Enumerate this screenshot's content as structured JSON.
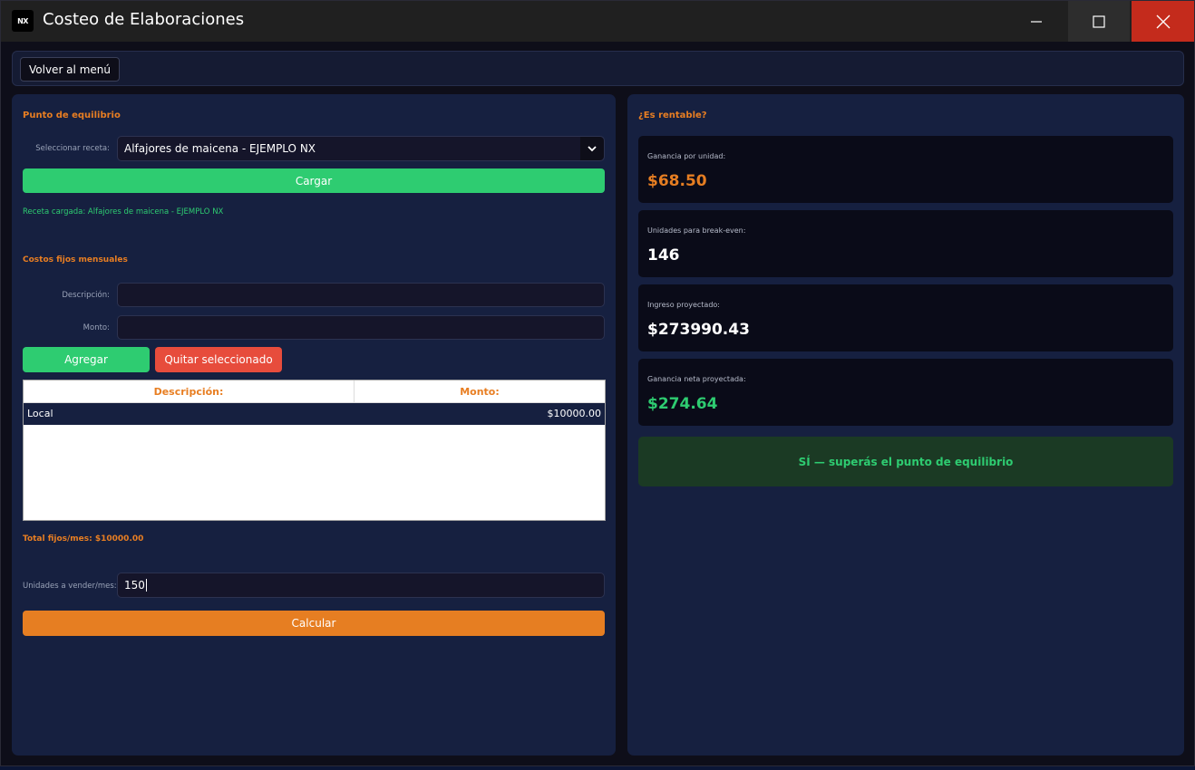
{
  "window": {
    "title": "Costeo de Elaboraciones",
    "app_icon_text": "NX"
  },
  "topbar": {
    "back_label": "Volver al menú"
  },
  "left": {
    "section_title": "Punto de equilibrio",
    "recipe_label": "Seleccionar receta:",
    "recipe_selected": "Alfajores de maicena - EJEMPLO NX",
    "load_label": "Cargar",
    "loaded_status": "Receta cargada: Alfajores de maicena - EJEMPLO NX",
    "fixed_title": "Costos fijos mensuales",
    "desc_label": "Descripción:",
    "desc_value": "",
    "monto_label": "Monto:",
    "monto_value": "",
    "add_label": "Agregar",
    "remove_label": "Quitar seleccionado",
    "table": {
      "headers": [
        "Descripción:",
        "Monto:"
      ],
      "rows": [
        {
          "desc": "Local",
          "monto": "$10000.00"
        }
      ]
    },
    "total_fixed": "Total fijos/mes: $10000.00",
    "units_label": "Unidades a vender/mes:",
    "units_value": "150",
    "calc_label": "Calcular"
  },
  "right": {
    "section_title": "¿Es rentable?",
    "cards": [
      {
        "label": "Ganancia por unidad:",
        "value": "$68.50",
        "color": "#e67e22"
      },
      {
        "label": "Unidades para break-even:",
        "value": "146",
        "color": "#ffffff"
      },
      {
        "label": "Ingreso proyectado:",
        "value": "$273990.43",
        "color": "#ffffff"
      },
      {
        "label": "Ganancia neta proyectada:",
        "value": "$274.64",
        "color": "#2ecc71"
      }
    ],
    "verdict": "SÍ — superás el punto de equilibrio"
  },
  "colors": {
    "accent_orange": "#e67e22",
    "accent_green": "#2ecc71",
    "accent_red": "#e74c3c",
    "panel_bg": "#162040"
  },
  "icons": {
    "minimize": "minimize-icon",
    "maximize": "maximize-icon",
    "close": "close-icon",
    "dropdown": "chevron-down-icon"
  }
}
